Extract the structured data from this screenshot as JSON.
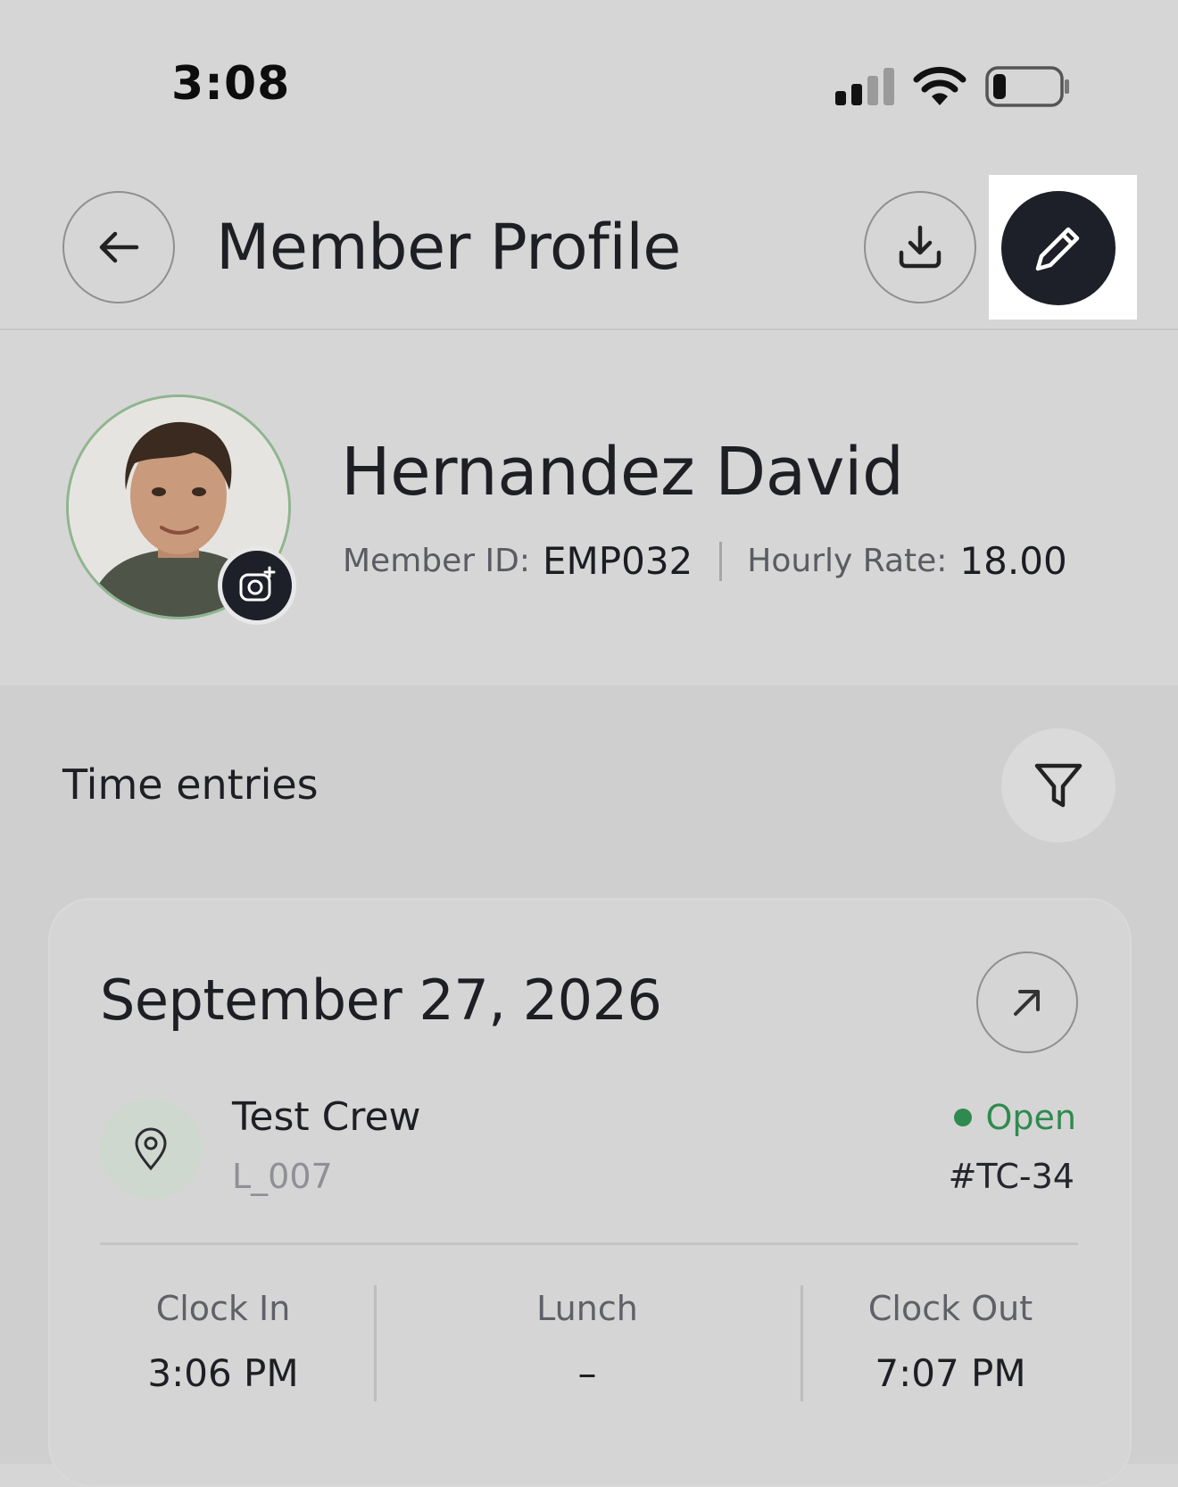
{
  "status_bar": {
    "time": "3:08"
  },
  "header": {
    "title": "Member Profile"
  },
  "profile": {
    "name": "Hernandez David",
    "member_id_label": "Member ID:",
    "member_id": "EMP032",
    "hourly_rate_label": "Hourly Rate:",
    "hourly_rate": "18.00"
  },
  "time_entries": {
    "title": "Time entries",
    "entries": [
      {
        "date": "September 27, 2026",
        "crew_name": "Test Crew",
        "crew_code": "L_007",
        "status": "Open",
        "ticket": "#TC-34",
        "clock_in_label": "Clock In",
        "clock_in": "3:06 PM",
        "lunch_label": "Lunch",
        "lunch": "–",
        "clock_out_label": "Clock Out",
        "clock_out": "7:07 PM"
      }
    ]
  },
  "icons": {
    "back": "arrow-left-icon",
    "download": "download-icon",
    "edit": "pencil-icon",
    "camera": "camera-add-icon",
    "filter": "filter-icon",
    "open": "arrow-up-right-icon",
    "location": "location-pin-icon"
  },
  "colors": {
    "accent_dark": "#1d2028",
    "status_open": "#2f8a4f",
    "background": "#d6d6d6"
  }
}
